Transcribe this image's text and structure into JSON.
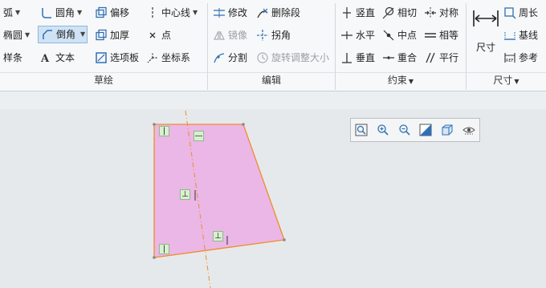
{
  "ribbon": {
    "sketch": {
      "label": "草绘",
      "arc": "弧",
      "ellipse": "椭圆",
      "spline": "样条",
      "fillet": "圆角",
      "chamfer": "倒角",
      "text": "文本",
      "offset": "偏移",
      "thicken": "加厚",
      "palette": "选项板",
      "centerline": "中心线",
      "point": "点",
      "coord_sys": "坐标系"
    },
    "edit": {
      "label": "编辑",
      "modify": "修改",
      "delete_segment": "删除段",
      "mirror": "镜像",
      "corner": "拐角",
      "divide": "分割",
      "rotate_resize": "旋转调整大小"
    },
    "constrain": {
      "label": "约束",
      "vertical": "竖直",
      "tangent": "相切",
      "symmetric": "对称",
      "horizontal": "水平",
      "midpoint": "中点",
      "equal": "相等",
      "perpendicular": "垂直",
      "coincident": "重合",
      "parallel": "平行"
    },
    "dimension": {
      "label": "尺寸",
      "dimension": "尺寸",
      "perimeter": "周长",
      "baseline": "基线",
      "reference": "参考"
    }
  },
  "sketch": {
    "fill_color": "#eab7e6",
    "edge_color": "#f08c2a",
    "constraint_symbols": {
      "vertical": "|",
      "horizontal": "—",
      "perpendicular": "⊥"
    }
  },
  "colors": {
    "ribbon_bg": "#f7f8f9",
    "canvas_bg": "#e6e9ec",
    "active_tool_bg": "#cfe3f5",
    "icon_blue": "#2f6fb5"
  }
}
